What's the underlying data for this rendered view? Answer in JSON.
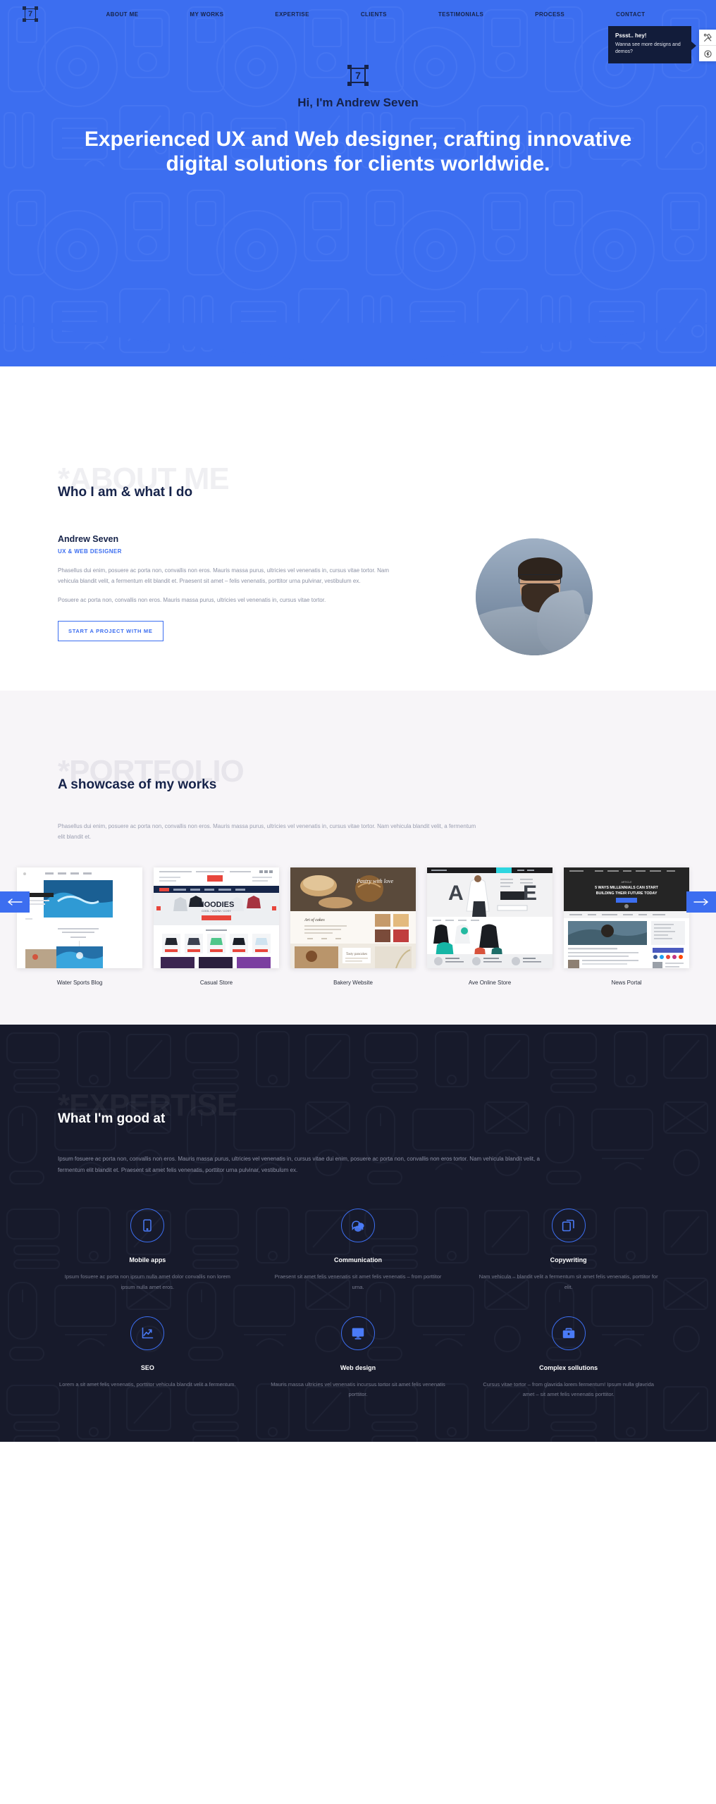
{
  "nav": {
    "logo_text": "7",
    "logo_name": "logo-seven-mark",
    "links": [
      {
        "label": "ABOUT ME"
      },
      {
        "label": "MY WORKS"
      },
      {
        "label": "EXPERTISE"
      },
      {
        "label": "CLIENTS"
      },
      {
        "label": "TESTIMONIALS"
      },
      {
        "label": "PROCESS"
      },
      {
        "label": "CONTACT"
      }
    ]
  },
  "popup": {
    "title": "Pssst.. hey!",
    "body": "Wanna see more designs and demos?"
  },
  "side_tools": {
    "tools_icon": "wrench-screwdriver-icon",
    "price_icon": "dollar-coin-icon"
  },
  "hero": {
    "logo_text": "7",
    "greeting": "Hi, I'm Andrew Seven",
    "headline": "Experienced UX and Web designer, crafting innovative digital solutions for clients worldwide.",
    "bg_color": "#3c6ef0"
  },
  "about": {
    "ghost": "*ABOUT ME",
    "title": "Who I am & what I do",
    "name": "Andrew Seven",
    "role": "UX & WEB DESIGNER",
    "paragraphs": [
      "Phasellus dui enim, posuere ac porta non, convallis non eros. Mauris massa purus, ultricies vel venenatis in, cursus vitae tortor. Nam vehicula blandit velit, a fermentum elit blandit et. Praesent sit amet – felis venenatis, porttitor urna pulvinar, vestibulum ex.",
      "Posuere ac porta non, convallis non eros. Mauris massa purus, ultricies vel venenatis in, cursus vitae tortor."
    ],
    "cta_label": "START A PROJECT WITH ME",
    "avatar_name": "profile-photo"
  },
  "portfolio": {
    "ghost": "*PORTFOLIO",
    "title": "A showcase of my works",
    "description": "Phasellus dui enim, posuere ac porta non, convallis non eros. Mauris massa purus, ultricies vel venenatis in, cursus vitae tortor. Nam vehicula blandit velit, a fermentum elit blandit et.",
    "prev_icon": "arrow-left-icon",
    "next_icon": "arrow-right-icon",
    "items": [
      {
        "caption": "Water Sports Blog"
      },
      {
        "caption": "Casual Store"
      },
      {
        "caption": "Bakery Website"
      },
      {
        "caption": "Ave Online Store"
      },
      {
        "caption": "News Portal"
      }
    ]
  },
  "expertise": {
    "ghost": "*EXPERTISE",
    "title": "What I'm good at",
    "description": "Ipsum fosuere ac porta non, convallis non eros. Mauris massa purus, ultricies vel venenatis in, cursus vitae dui enim, posuere ac porta non, convallis non eros tortor. Nam vehicula blandit velit, a fermentum elit blandit et. Praesent sit amet felis venenatis, porttitor urna pulvinar, vestibulum ex.",
    "cards": [
      {
        "icon": "tablet-icon",
        "title": "Mobile apps",
        "text": "Ipsum fosuere ac porta non ipsum nulla amet dolor convallis non lorem ipsum nulla amet eros."
      },
      {
        "icon": "chat-bubbles-icon",
        "title": "Communication",
        "text": "Praesent sit amet felis venenatis sit amet felis venenatis – from porttitor urna."
      },
      {
        "icon": "copy-documents-icon",
        "title": "Copywriting",
        "text": "Nam vehicula – blandit velit a fermentum sit amet felis venenatis, porttitor for elit."
      },
      {
        "icon": "growth-chart-icon",
        "title": "SEO",
        "text": "Lorem a sit amet felis venenatis, porttitor vehicula blandit velit a fermentum."
      },
      {
        "icon": "monitor-icon",
        "title": "Web design",
        "text": "Mauris massa ultricies vel venenatis incursus tortor sit amet felis venenatis porttitor."
      },
      {
        "icon": "briefcase-icon",
        "title": "Complex sollutions",
        "text": "Cursus vitae tortor – from glavrida lorem fermentum! Ipsum nulla glavrida amet – sit amet felis venenatis porttitor."
      }
    ]
  }
}
